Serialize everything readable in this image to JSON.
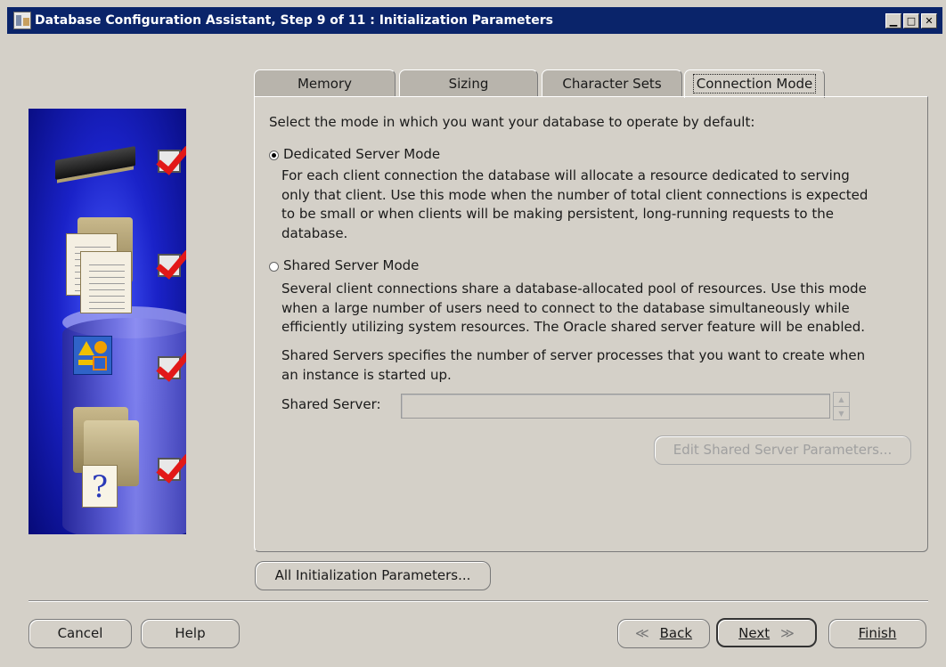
{
  "window": {
    "title": "Database Configuration Assistant, Step 9 of 11 : Initialization Parameters",
    "minimize_label": "▁",
    "maximize_label": "□",
    "close_label": "✕"
  },
  "tabs": [
    {
      "label": "Memory",
      "active": false
    },
    {
      "label": "Sizing",
      "active": false
    },
    {
      "label": "Character Sets",
      "active": false
    },
    {
      "label": "Connection Mode",
      "active": true
    }
  ],
  "connection_mode": {
    "instruction": "Select the mode in which you want your database to operate by default:",
    "dedicated": {
      "label": "Dedicated Server Mode",
      "selected": true,
      "description_lines": [
        "For each client connection the database will allocate a resource dedicated to serving",
        "only that client.  Use this mode when the number of total client connections is expected",
        "to be small or when clients will be making persistent, long-running requests to the",
        "database."
      ]
    },
    "shared": {
      "label": "Shared Server Mode",
      "selected": false,
      "description_lines": [
        "Several client connections share a database-allocated pool of resources.  Use this mode",
        "when a large number of users need to connect to the database simultaneously while",
        "efficiently utilizing system resources.  The Oracle shared server feature will be enabled."
      ],
      "shared_servers_lines": [
        "Shared Servers specifies the number of server processes that you want to create when",
        "an instance is started up."
      ],
      "shared_server_label": "Shared Server:",
      "shared_server_value": "",
      "spinner_up": "▲",
      "spinner_down": "▼",
      "edit_button": "Edit Shared Server Parameters..."
    }
  },
  "all_params_button": "All Initialization Parameters...",
  "footer": {
    "cancel": "Cancel",
    "help": "Help",
    "back_arrow": "≪",
    "back": "Back",
    "next": "Next",
    "next_arrow": "≫",
    "finish": "Finish"
  },
  "colors": {
    "titlebar": "#0a246a",
    "dialog_bg": "#d4d0c8",
    "side_panel": "#1a22c8",
    "checkmark": "#e21818"
  }
}
